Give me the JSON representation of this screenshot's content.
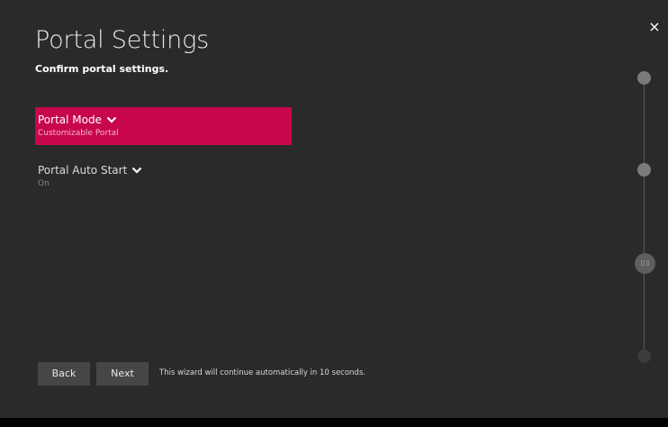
{
  "header": {
    "title": "Portal Settings",
    "subtitle": "Confirm portal settings."
  },
  "close_icon": "×",
  "options": [
    {
      "label": "Portal Mode",
      "value": "Customizable Portal",
      "selected": true,
      "icon": "chevron-down-icon"
    },
    {
      "label": "Portal Auto Start",
      "value": "On",
      "selected": false,
      "icon": "chevron-down-icon"
    }
  ],
  "progress": {
    "current_step_label": "03",
    "steps_total": 4,
    "current_step": 3
  },
  "footer": {
    "back_label": "Back",
    "next_label": "Next",
    "note": "This wizard will continue automatically in 10 seconds."
  },
  "colors": {
    "background": "#2a2a2a",
    "accent": "#c8064c",
    "button": "#464646"
  }
}
